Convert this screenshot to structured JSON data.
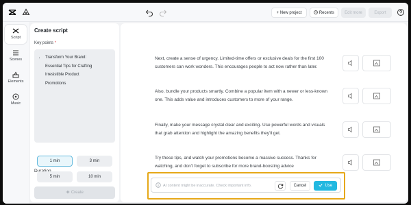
{
  "topbar": {
    "new_project": "+ New project",
    "recents": "Recents",
    "edit_more": "Edit more",
    "export": "Export"
  },
  "rail": {
    "items": [
      {
        "label": "Script",
        "icon": "script-icon"
      },
      {
        "label": "Scenes",
        "icon": "scenes-icon"
      },
      {
        "label": "Elements",
        "icon": "elements-icon"
      },
      {
        "label": "Music",
        "icon": "music-icon"
      }
    ]
  },
  "panel": {
    "title": "Create script",
    "key_points_label": "Key points",
    "required_mark": "*",
    "key_points": [
      "Transform Your Brand:",
      "Essential Tips for Crafting",
      "Irresistible Product",
      "Promotions"
    ],
    "duration_label": "Duration",
    "durations": [
      "1 min",
      "3 min",
      "5 min",
      "10 min"
    ],
    "selected_duration": "1 min",
    "create_label": "Create"
  },
  "main": {
    "paragraphs": [
      "Next, create a sense of urgency. Limited-time offers or exclusive deals for the first 100 customers can work wonders. This encourages people to act now rather than later.",
      "Also, bundle your products smartly. Combine a popular item with a newer or less-known one. This adds value and introduces customers to more of your range.",
      "Finally, make your message crystal clear and exciting. Use powerful words and visuals that grab attention and highlight the amazing benefits they'll get.",
      "Try these tips, and watch your promotions become a massive success. Thanks for watching, and don't forget to subscribe for more brand-boosting advice"
    ]
  },
  "ai_bar": {
    "placeholder": "AI content might be inaccurate. Check important info.",
    "cancel": "Cancel",
    "use": "Use"
  },
  "colors": {
    "accent": "#22b8e0",
    "highlight": "#e6a817"
  }
}
